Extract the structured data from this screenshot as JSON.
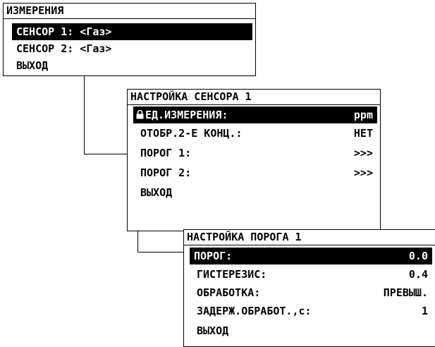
{
  "menu_measure": {
    "title": "ИЗМЕРЕНИЯ",
    "items": [
      {
        "label": "СЕНСОР 1: <Газ>"
      },
      {
        "label": "СЕНСОР 2: <Газ>"
      },
      {
        "label": "ВЫХОД"
      }
    ]
  },
  "menu_sensor": {
    "title": "НАСТРОЙКА СЕНСОРА 1",
    "items": [
      {
        "label": "ЕД.ИЗМЕРЕНИЯ:",
        "value": "ppm",
        "icon": "lock-icon"
      },
      {
        "label": "ОТОБР.2-Е КОНЦ.:",
        "value": "НЕТ"
      },
      {
        "label": "ПОРОГ 1:",
        "value": ">>>"
      },
      {
        "label": "ПОРОГ 2:",
        "value": ">>>"
      },
      {
        "label": "ВЫХОД",
        "value": ""
      }
    ]
  },
  "menu_threshold": {
    "title": "НАСТРОЙКА ПОРОГА 1",
    "items": [
      {
        "label": "ПОРОГ:",
        "value": "0.0"
      },
      {
        "label": "ГИСТЕРЕЗИС:",
        "value": "0.4"
      },
      {
        "label": "ОБРАБОТКА:",
        "value": "ПРЕВЫШ."
      },
      {
        "label": "ЗАДЕРЖ.ОБРАБОТ.,с:",
        "value": "1"
      },
      {
        "label": "ВЫХОД",
        "value": ""
      }
    ]
  }
}
